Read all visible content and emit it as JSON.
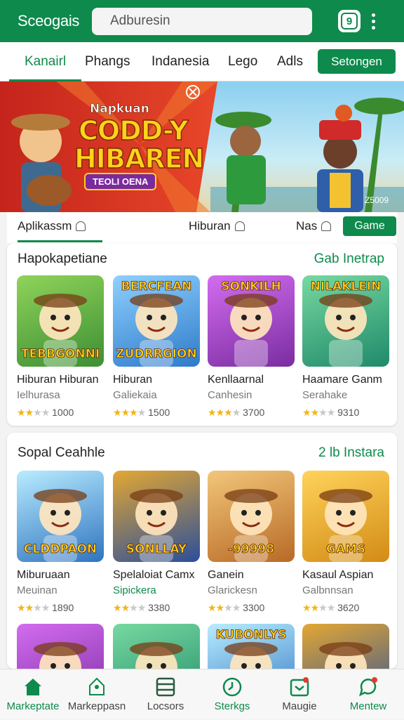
{
  "app": {
    "title": "Sceogais"
  },
  "search": {
    "value": "Adburesin"
  },
  "header_icon": {
    "name": "app-badge-icon",
    "glyph": "9"
  },
  "nav": {
    "tabs": [
      {
        "label": "Kanairl",
        "active": true
      },
      {
        "label": "Phangs"
      },
      {
        "label": "Indanesia"
      },
      {
        "label": "Lego"
      },
      {
        "label": "Adls"
      }
    ],
    "button": "Setongen"
  },
  "banner": {
    "line1": "Napkuan",
    "title": "CODD-Y",
    "title2": "HIBAREN",
    "sub": "TEOLI OENA",
    "badge": "Z5009"
  },
  "subtabs": [
    {
      "label": "Aplikassm",
      "active": true
    },
    {
      "label": "Hiburan"
    },
    {
      "label": "Nas"
    }
  ],
  "subtab_button": "Game",
  "sections": [
    {
      "title": "Hapokapetiane",
      "link": "Gab Inetrap",
      "apps": [
        {
          "thumb_text": "TEBBGONNI",
          "thumb_top": "",
          "name": "Hiburan Hiburan",
          "sub": "Ielhurasa",
          "stars": 2,
          "count": "1000"
        },
        {
          "thumb_text": "ZUDRRGION",
          "thumb_top": "BERCFEAN",
          "name": "Hiburan",
          "sub": "Galiekaia",
          "stars": 3,
          "count": "1500"
        },
        {
          "thumb_text": "",
          "thumb_top": "SONKILH",
          "name": "Kenllaarnal",
          "sub": "Canhesin",
          "stars": 3,
          "count": "3700"
        },
        {
          "thumb_text": "",
          "thumb_top": "NILAKLEIN",
          "name": "Haamare Ganm",
          "sub": "Serahake",
          "stars": 2,
          "count": "9310"
        }
      ]
    },
    {
      "title": "Sopal Ceahhle",
      "link": "2 lb Instara",
      "apps": [
        {
          "thumb_text": "CLDDPAON",
          "thumb_top": "",
          "name": "Miburuaan",
          "sub": "Meuinan",
          "stars": 2,
          "count": "1890"
        },
        {
          "thumb_text": "SONLLAY",
          "thumb_top": "",
          "name": "Spelaloiat Camx",
          "sub": "Sipickera",
          "sub_green": true,
          "stars": 2,
          "count": "3380"
        },
        {
          "thumb_text": "-99998",
          "thumb_top": "",
          "name": "Ganein",
          "sub": "Glarickesn",
          "stars": 2,
          "count": "3300"
        },
        {
          "thumb_text": "GAMS",
          "thumb_top": "",
          "name": "Kasaul Aspian",
          "sub": "Galbnnsan",
          "stars": 2,
          "count": "3620"
        }
      ]
    }
  ],
  "row3": [
    {
      "thumb_top": ""
    },
    {
      "thumb_top": ""
    },
    {
      "thumb_top": "KUBONLYS"
    },
    {
      "thumb_top": ""
    }
  ],
  "bottom_nav": [
    {
      "label": "Markeptate",
      "icon": "home-icon",
      "active": true
    },
    {
      "label": "Markeppasn",
      "icon": "bell-icon"
    },
    {
      "label": "Locsors",
      "icon": "list-icon"
    },
    {
      "label": "Sterkgs",
      "icon": "clock-icon"
    },
    {
      "label": "Maugie",
      "icon": "inbox-icon"
    },
    {
      "label": "Mentew",
      "icon": "chat-icon"
    }
  ],
  "colors": {
    "accent": "#0e8a4c",
    "star": "#f2b417"
  }
}
